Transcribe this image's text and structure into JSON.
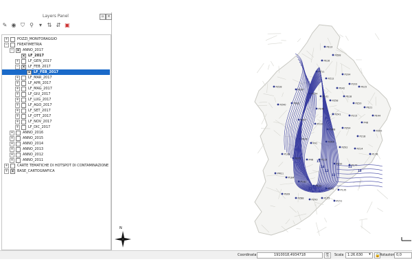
{
  "panel": {
    "title": "Layers Panel",
    "tree": [
      {
        "label": "POZZI_MONITORAGGIO",
        "indent": 0,
        "expander": "+",
        "check": "",
        "selected": false
      },
      {
        "label": "FREATIMETRIA",
        "indent": 0,
        "expander": "−",
        "check": "",
        "selected": false
      },
      {
        "label": "ANNO_2017",
        "indent": 1,
        "expander": "−",
        "check": "x",
        "selected": false
      },
      {
        "label": "LF_2017",
        "indent": 2,
        "expander": "",
        "check": "x",
        "selected": false,
        "bold": true
      },
      {
        "label": "LF_GEN_2017",
        "indent": 2,
        "expander": "+",
        "check": "",
        "selected": false
      },
      {
        "label": "LF_FEB_2017",
        "indent": 2,
        "expander": "−",
        "check": "x",
        "selected": false
      },
      {
        "label": "LF_FEB_2017",
        "indent": 3,
        "expander": "",
        "check": "x",
        "selected": true,
        "bold": true
      },
      {
        "label": "LF_MAR_2017",
        "indent": 2,
        "expander": "+",
        "check": "",
        "selected": false
      },
      {
        "label": "LF_APR_2017",
        "indent": 2,
        "expander": "+",
        "check": "",
        "selected": false
      },
      {
        "label": "LF_MAG_2017",
        "indent": 2,
        "expander": "+",
        "check": "",
        "selected": false
      },
      {
        "label": "LF_GIU_2017",
        "indent": 2,
        "expander": "+",
        "check": "",
        "selected": false
      },
      {
        "label": "LF_LUG_2017",
        "indent": 2,
        "expander": "+",
        "check": "",
        "selected": false
      },
      {
        "label": "LF_AGO_2017",
        "indent": 2,
        "expander": "+",
        "check": "",
        "selected": false
      },
      {
        "label": "LF_SET_2017",
        "indent": 2,
        "expander": "+",
        "check": "",
        "selected": false
      },
      {
        "label": "LF_OTT_2017",
        "indent": 2,
        "expander": "+",
        "check": "",
        "selected": false
      },
      {
        "label": "LF_NOV_2017",
        "indent": 2,
        "expander": "+",
        "check": "",
        "selected": false
      },
      {
        "label": "LF_DIC_2017",
        "indent": 2,
        "expander": "+",
        "check": "",
        "selected": false
      },
      {
        "label": "ANNO_2016",
        "indent": 1,
        "expander": "+",
        "check": "",
        "selected": false
      },
      {
        "label": "ANNO_2015",
        "indent": 1,
        "expander": "+",
        "check": "",
        "selected": false
      },
      {
        "label": "ANNO_2014",
        "indent": 1,
        "expander": "+",
        "check": "",
        "selected": false
      },
      {
        "label": "ANNO_2013",
        "indent": 1,
        "expander": "+",
        "check": "",
        "selected": false
      },
      {
        "label": "ANNO_2012",
        "indent": 1,
        "expander": "+",
        "check": "",
        "selected": false
      },
      {
        "label": "ANNO_2011",
        "indent": 1,
        "expander": "+",
        "check": "",
        "selected": false
      },
      {
        "label": "CARTE TEMATICHE DI HOTSPOT DI CONTAMINAZIONE",
        "indent": 0,
        "expander": "+",
        "check": "",
        "selected": false
      },
      {
        "label": "BASE_CARTOGRAFICA",
        "indent": 0,
        "expander": "+",
        "check": "x",
        "selected": false
      }
    ]
  },
  "map": {
    "well_labels": [
      "PE13",
      "PZ08",
      "PE16",
      "PZ11",
      "PZ12",
      "P204",
      "P203",
      "PE15",
      "PE42",
      "PE09",
      "P104",
      "P101",
      "PZ58",
      "PE18",
      "PZ20",
      "PE21",
      "PE44",
      "PE02",
      "PZ28",
      "PZ40",
      "PE40",
      "PZ41",
      "P215",
      "P48",
      "PZ05",
      "PZ07",
      "P210",
      "P308",
      "PZ04",
      "P218",
      "PE35",
      "P41",
      "PZ03",
      "PZ02",
      "PZ14",
      "P176",
      "P109",
      "PE35",
      "P46",
      "P115",
      "P150",
      "P177",
      "PM11",
      "P184",
      "P182",
      "P122",
      "P152",
      "P135",
      "PE09",
      "PZ88",
      "PZ43",
      "P155",
      "P151"
    ],
    "contour_labels": [
      "12",
      "13",
      "14",
      "15",
      "12",
      "11",
      "10"
    ],
    "north_label": "N"
  },
  "status": {
    "coord_label": "Coordinata",
    "coord_value": "1910018,4934718",
    "scale_label": "Scala",
    "scale_value": "1:26.630",
    "rotation_label": "Rotazione",
    "rotation_value": "0,0"
  }
}
